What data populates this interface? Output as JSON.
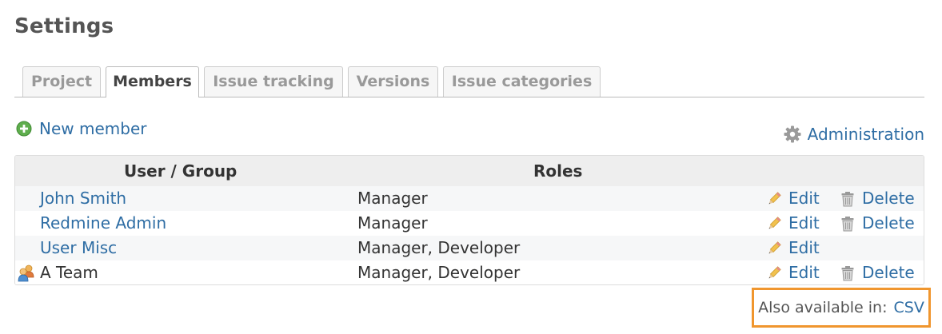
{
  "page": {
    "title": "Settings"
  },
  "tabs": [
    {
      "label": "Project",
      "selected": false
    },
    {
      "label": "Members",
      "selected": true
    },
    {
      "label": "Issue tracking",
      "selected": false
    },
    {
      "label": "Versions",
      "selected": false
    },
    {
      "label": "Issue categories",
      "selected": false
    }
  ],
  "toolbar": {
    "new_member": {
      "label": "New member",
      "icon": "add-icon"
    },
    "administration": {
      "label": "Administration",
      "icon": "gear-icon"
    }
  },
  "members_table": {
    "headers": {
      "user": "User / Group",
      "roles": "Roles"
    },
    "rows": [
      {
        "name": "John Smith",
        "roles": "Manager",
        "edit": "Edit",
        "delete": "Delete",
        "is_group": false
      },
      {
        "name": "Redmine Admin",
        "roles": "Manager",
        "edit": "Edit",
        "delete": "Delete",
        "is_group": false
      },
      {
        "name": "User Misc",
        "roles": "Manager, Developer",
        "edit": "Edit",
        "delete": null,
        "is_group": false
      },
      {
        "name": "A Team",
        "roles": "Manager, Developer",
        "edit": "Edit",
        "delete": "Delete",
        "is_group": true,
        "icon": "group-icon"
      }
    ]
  },
  "footer": {
    "also_available": "Also available in:",
    "csv": "CSV"
  },
  "colors": {
    "link": "#2e6da4",
    "highlight": "#f0962e",
    "header_bg": "#eeeeee"
  }
}
